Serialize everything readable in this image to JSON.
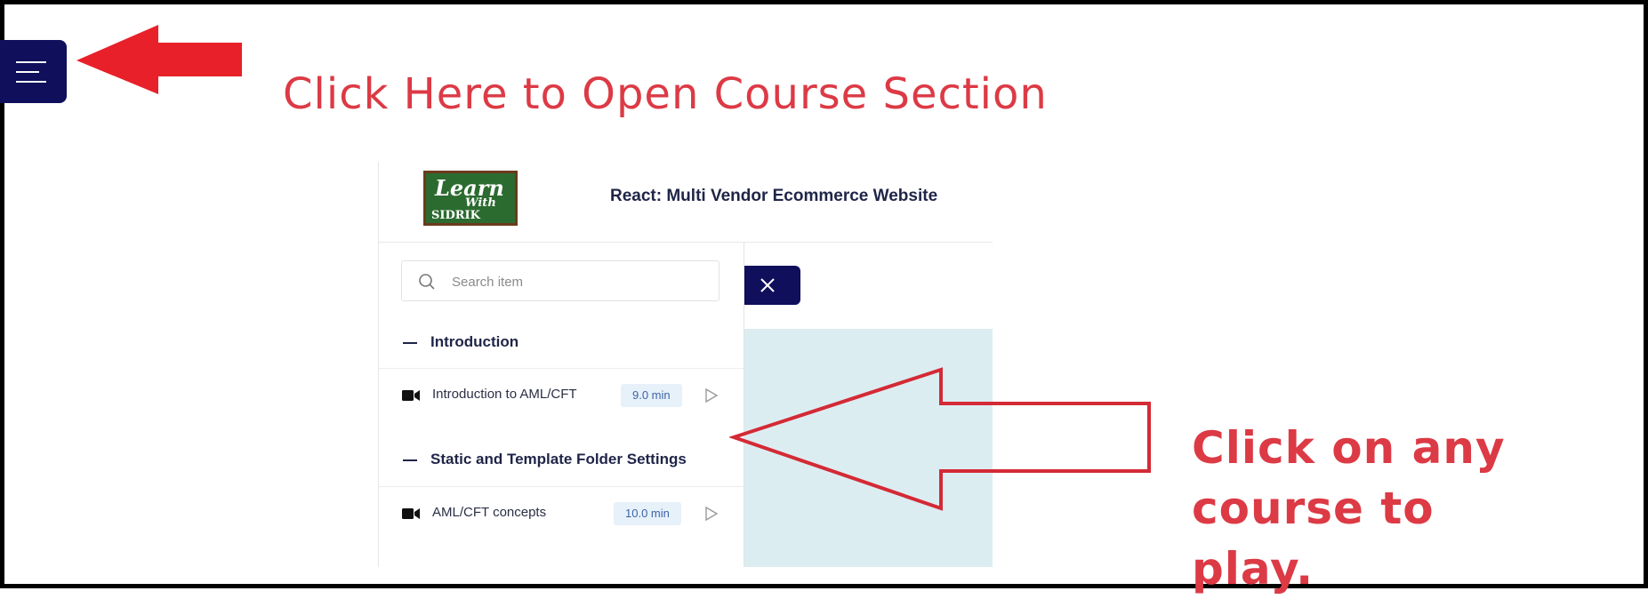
{
  "annotations": {
    "top_callout": "Click Here to Open Course Section",
    "right_callout": "Click on any course to play."
  },
  "header": {
    "logo_line1": "Learn",
    "logo_line2": "With",
    "logo_line3": "SIDRIK",
    "course_title": "React: Multi Vendor Ecommerce Website"
  },
  "search": {
    "placeholder": "Search item"
  },
  "sections": [
    {
      "label": "Introduction",
      "items": [
        {
          "title": "Introduction to AML/CFT",
          "duration": "9.0 min"
        }
      ]
    },
    {
      "label": "Static and Template Folder Settings",
      "items": [
        {
          "title": "AML/CFT concepts",
          "duration": "10.0 min"
        }
      ]
    }
  ],
  "colors": {
    "annotation_red": "#dc3a45",
    "navy": "#0f0f5c",
    "badge_bg": "#e7f1fa"
  },
  "icons": [
    "menu-icon",
    "close-icon",
    "search-icon",
    "video-camera-icon",
    "play-icon"
  ]
}
